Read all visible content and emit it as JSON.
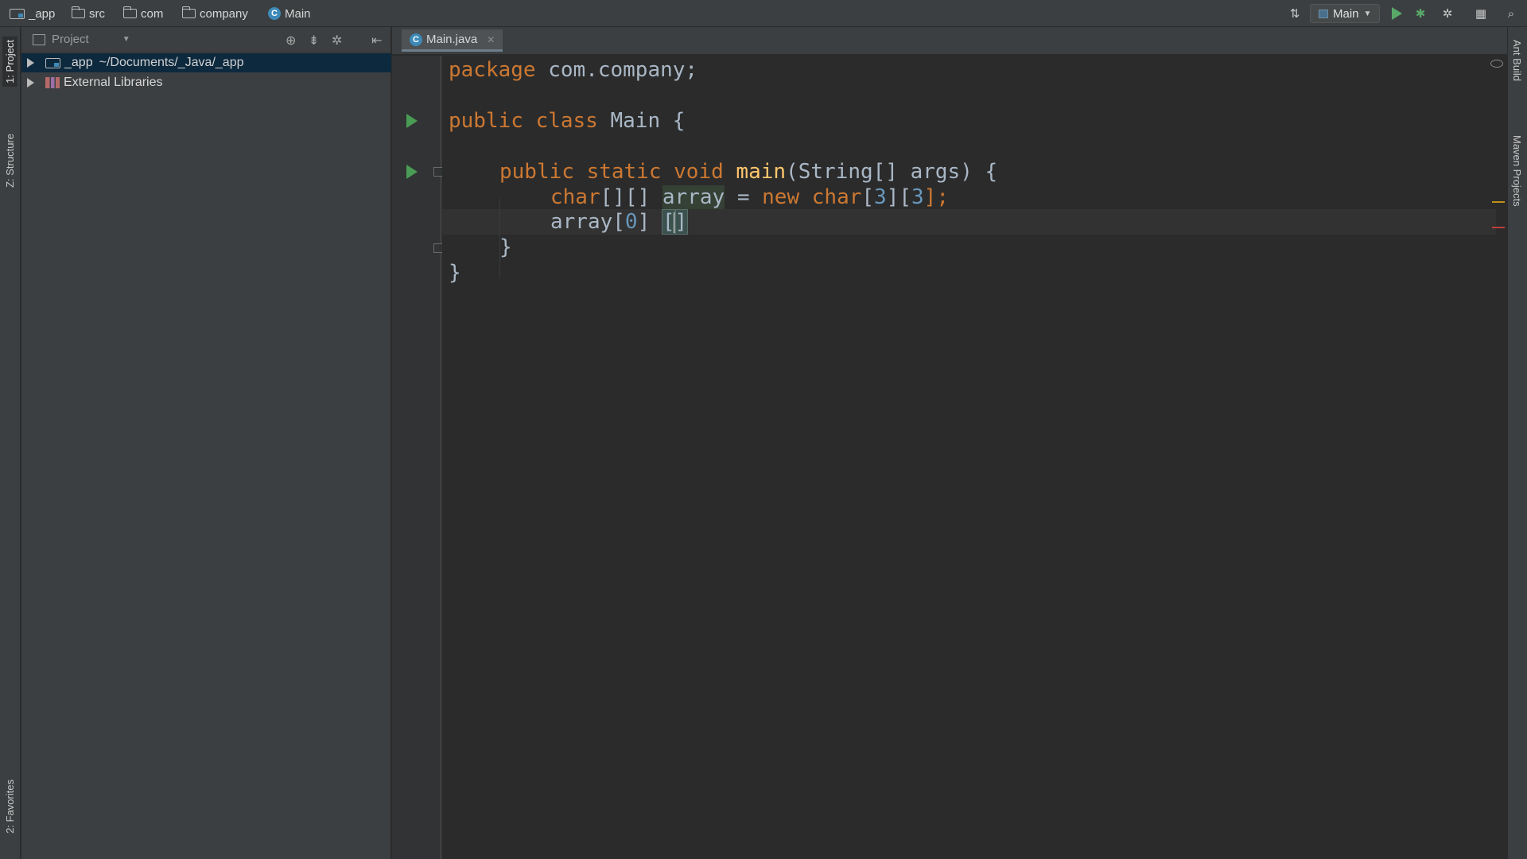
{
  "breadcrumbs": [
    {
      "label": "_app",
      "icon": "module-folder-icon"
    },
    {
      "label": "src",
      "icon": "folder-icon"
    },
    {
      "label": "com",
      "icon": "folder-icon"
    },
    {
      "label": "company",
      "icon": "folder-icon"
    },
    {
      "label": "Main",
      "icon": "class-icon"
    }
  ],
  "toolbar": {
    "run_config": "Main",
    "icons": [
      "build-icon",
      "run-icon",
      "debug-icon",
      "coverage-icon",
      "project-structure-icon",
      "search-icon"
    ]
  },
  "left_tool_tabs": {
    "project": "1: Project",
    "structure": "Z: Structure",
    "favorites": "2: Favorites"
  },
  "right_tool_tabs": {
    "ant": "Ant Build",
    "maven": "Maven Projects"
  },
  "project_panel": {
    "title": "Project",
    "tree": [
      {
        "name": "_app",
        "path": "~/Documents/_Java/_app",
        "selected": true
      },
      {
        "name": "External Libraries",
        "path": "",
        "selected": false
      }
    ]
  },
  "editor": {
    "tab_label": "Main.java",
    "class_icon_letter": "C",
    "code": {
      "l1_kw": "package",
      "l1_rest": " com.company;",
      "l2_kw": "public class",
      "l2_name": " Main {",
      "l3_kw": "public static void",
      "l3_fn": "main",
      "l3_rest": "(String[] args) {",
      "l4_type": "char",
      "l4_dims": "[][] ",
      "l4_var": "array",
      "l4_eq": " = ",
      "l4_new": "new char",
      "l4_b1": "[",
      "l4_n1": "3",
      "l4_b2": "][",
      "l4_n2": "3",
      "l4_end": "];",
      "l5_a": "array[",
      "l5_n": "0",
      "l5_b": "] ",
      "l5_open": "[",
      "l5_close": "]",
      "l6": "}",
      "l7": "}"
    }
  },
  "colors": {
    "keyword": "#cc7832",
    "function": "#ffc66d",
    "number": "#6897bb",
    "default": "#a9b7c6",
    "selection": "#0d293e",
    "run_green": "#499c54"
  }
}
